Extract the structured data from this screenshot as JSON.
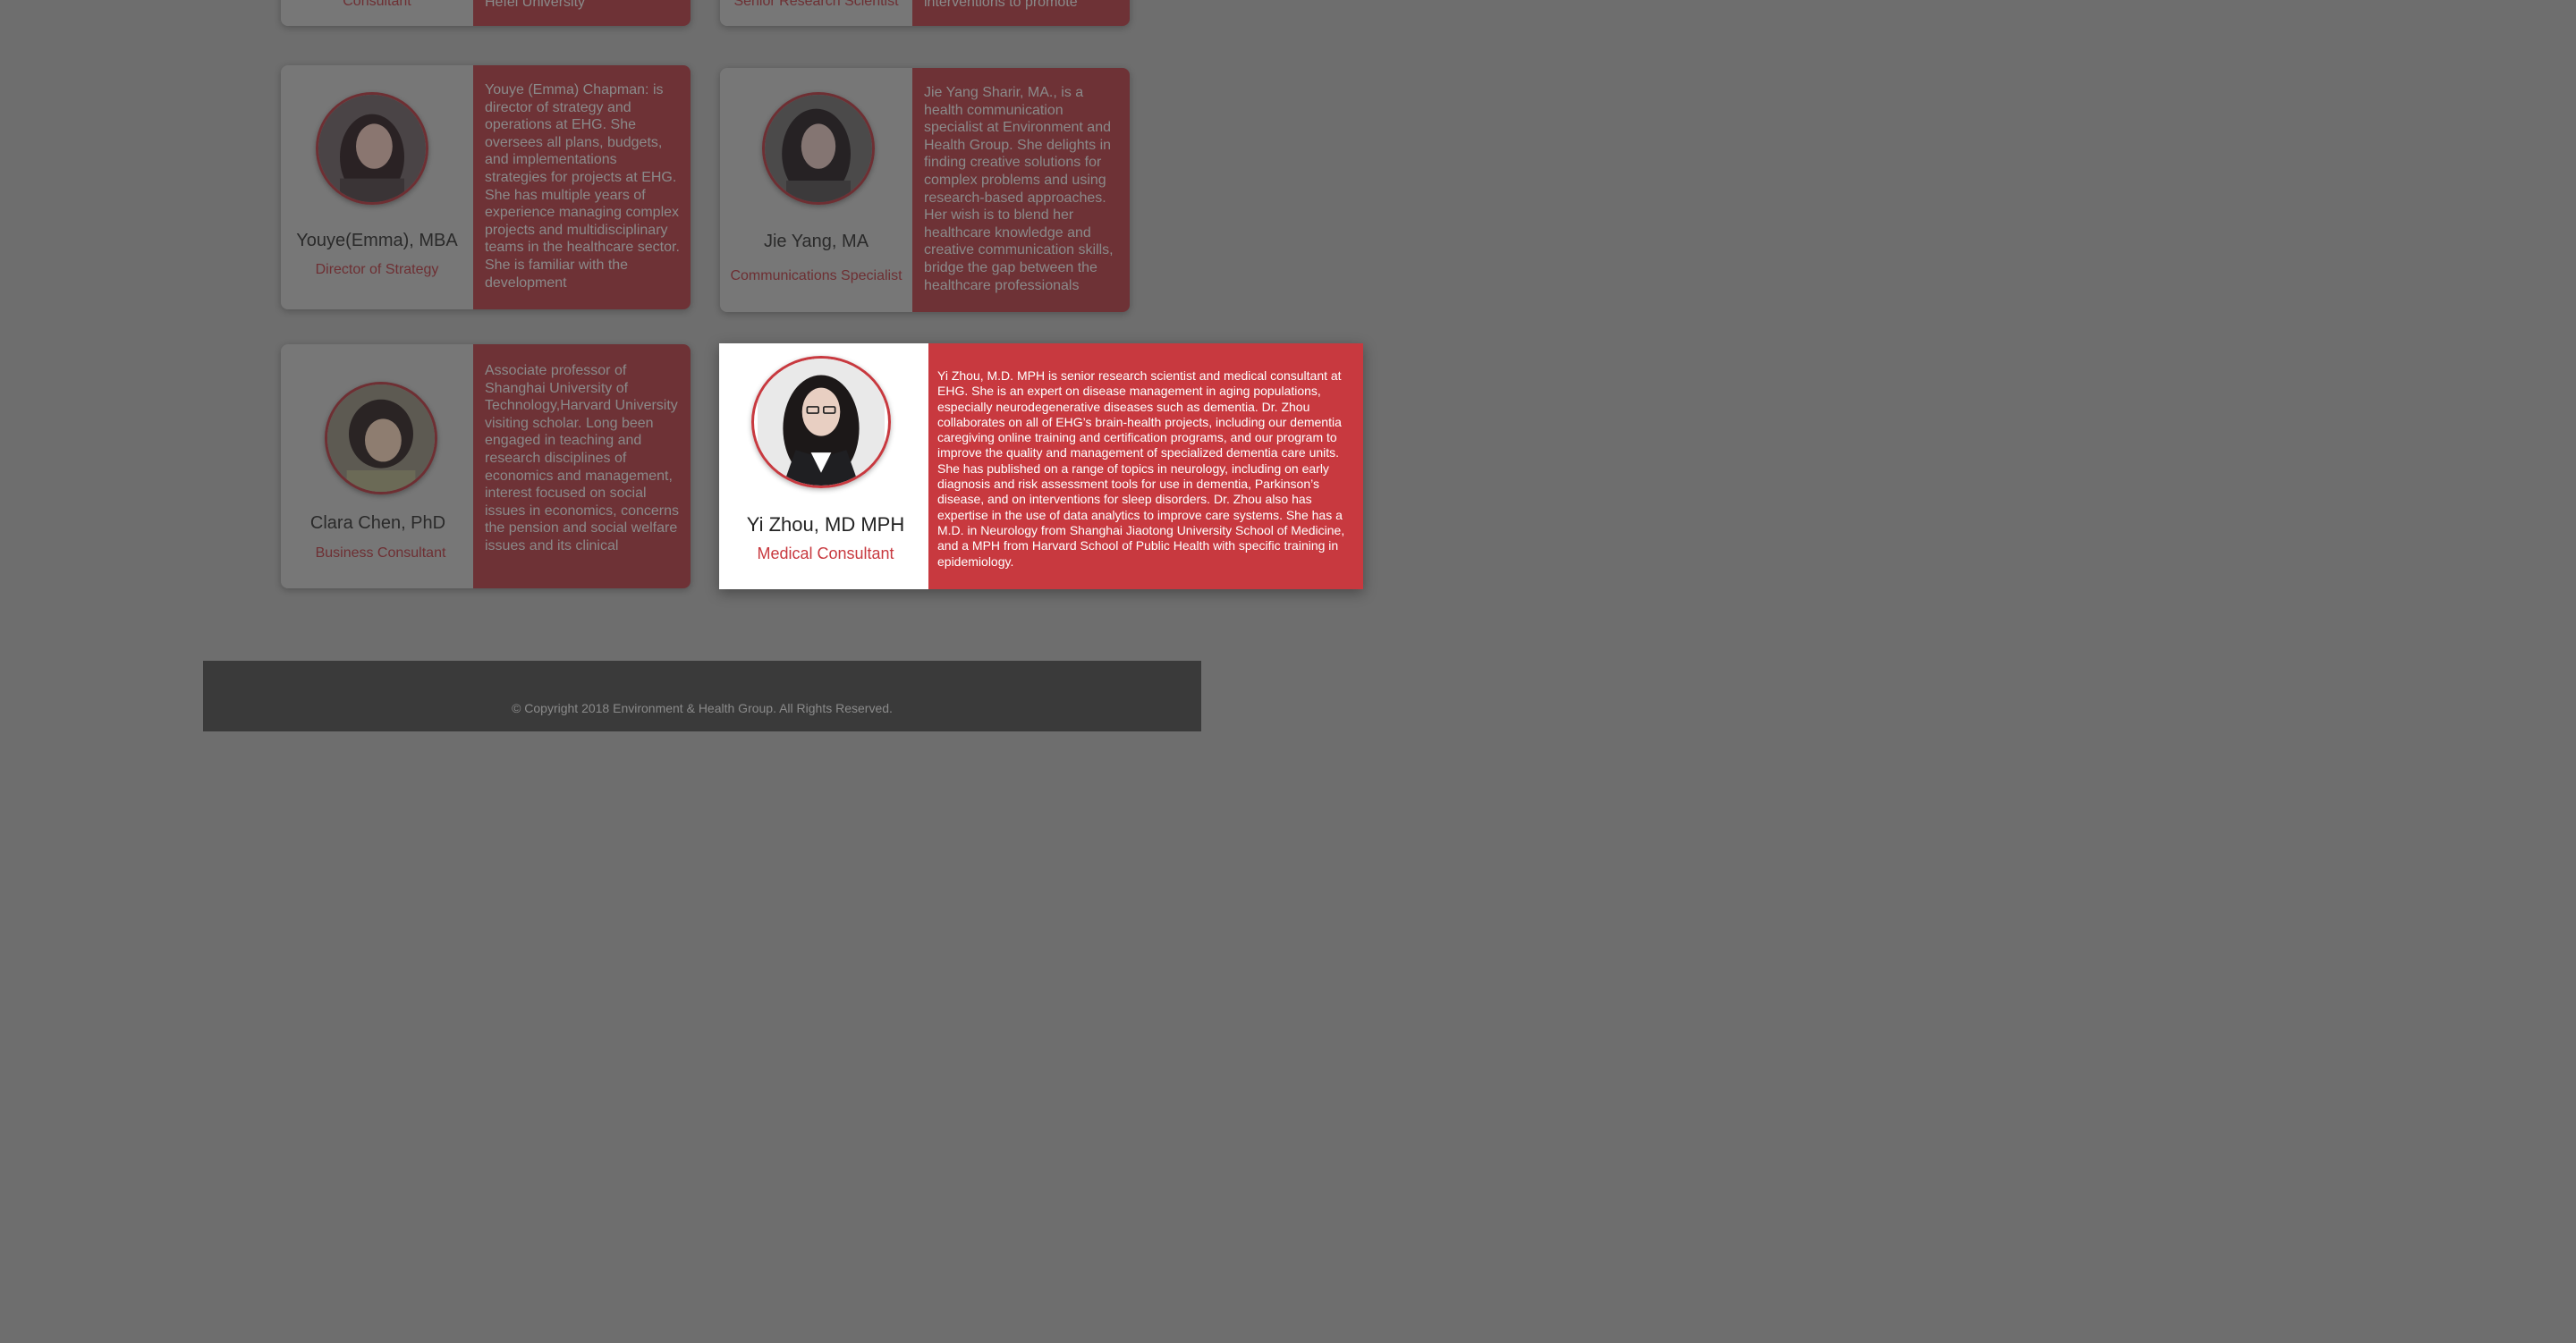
{
  "top_partial": {
    "card1_role": "Consultant",
    "card1_text": "Hefei University",
    "card2_role": "Senior Research Scientist",
    "card2_text": "interventions to promote"
  },
  "team": [
    {
      "name": "Youye(Emma), MBA",
      "role": "Director of Strategy",
      "bio": "Youye (Emma) Chapman: is director of strategy and operations at EHG. She oversees all plans, budgets, and implementations strategies for projects at EHG. She has multiple years of experience managing complex projects and multidisciplinary teams in the healthcare sector. She is familiar with the development"
    },
    {
      "name": "Jie Yang, MA",
      "role": "Communications Specialist",
      "bio": "Jie Yang Sharir, MA., is a health communication specialist at Environment and Health Group. She delights in finding creative solutions for complex problems and using research-based approaches. Her wish is to blend her healthcare knowledge and creative communication skills, bridge the gap between the healthcare professionals"
    },
    {
      "name": "Clara Chen, PhD",
      "role": "Business Consultant",
      "bio": "Associate professor of Shanghai University of Technology,Harvard University visiting scholar. Long been engaged in teaching and research disciplines of economics and management, interest focused on social issues in economics, concerns the pension and social welfare issues and its clinical"
    },
    {
      "name": "Yi Zhou, MD MPH",
      "role": "Medical Consultant",
      "bio": "Yi Zhou, M.D. MPH is senior research scientist and medical consultant at EHG. She is an expert on disease management in aging populations, especially neurodegenerative diseases such as dementia.  Dr. Zhou collaborates on all of EHG’s brain-health projects, including our dementia caregiving online training and certification programs, and our program to improve the quality and management of specialized dementia care units. She has published on a range of topics in neurology, including on early diagnosis and risk assessment tools for use in dementia, Parkinson’s disease, and on interventions for sleep disorders.  Dr. Zhou also has expertise in the use of data analytics to improve care systems.  She has a M.D. in Neurology from Shanghai Jiaotong University School of Medicine, and a MPH from Harvard School of Public Health with specific training in epidemiology."
    }
  ],
  "footer": {
    "copyright": "© Copyright 2018 Environment & Health Group.  All Rights Reserved."
  },
  "colors": {
    "accent": "#c8393f",
    "overlay": "#6e6e6e",
    "footer_bg": "#3a3a3a"
  }
}
